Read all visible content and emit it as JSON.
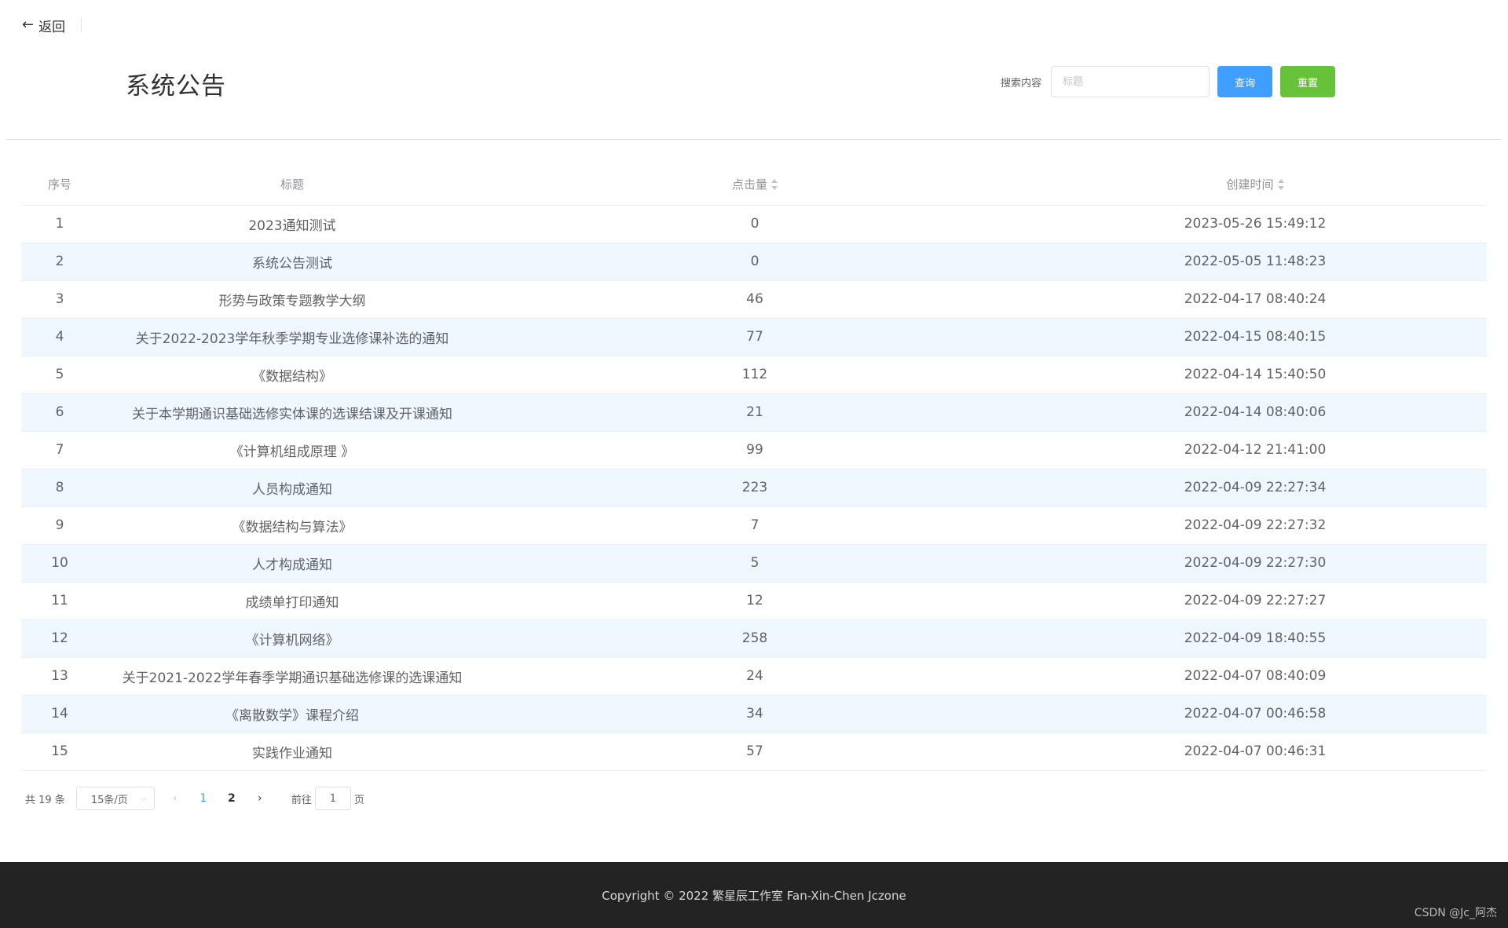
{
  "header": {
    "back_arrow": "←",
    "back_label": "返回",
    "title": "系统公告"
  },
  "search": {
    "label": "搜索内容",
    "placeholder": "标题",
    "value": "",
    "query_label": "查询",
    "reset_label": "重置"
  },
  "table": {
    "columns": [
      "序号",
      "标题",
      "点击量",
      "创建时间"
    ],
    "rows": [
      {
        "no": "1",
        "title": "2023通知测试",
        "clicks": "0",
        "created": "2023-05-26 15:49:12"
      },
      {
        "no": "2",
        "title": "系统公告测试",
        "clicks": "0",
        "created": "2022-05-05 11:48:23"
      },
      {
        "no": "3",
        "title": "形势与政策专题教学大纲",
        "clicks": "46",
        "created": "2022-04-17 08:40:24"
      },
      {
        "no": "4",
        "title": "关于2022-2023学年秋季学期专业选修课补选的通知",
        "clicks": "77",
        "created": "2022-04-15 08:40:15"
      },
      {
        "no": "5",
        "title": "《数据结构》",
        "clicks": "112",
        "created": "2022-04-14 15:40:50"
      },
      {
        "no": "6",
        "title": "关于本学期通识基础选修实体课的选课结课及开课通知",
        "clicks": "21",
        "created": "2022-04-14 08:40:06"
      },
      {
        "no": "7",
        "title": "《计算机组成原理 》",
        "clicks": "99",
        "created": "2022-04-12 21:41:00"
      },
      {
        "no": "8",
        "title": "人员构成通知",
        "clicks": "223",
        "created": "2022-04-09 22:27:34"
      },
      {
        "no": "9",
        "title": "《数据结构与算法》",
        "clicks": "7",
        "created": "2022-04-09 22:27:32"
      },
      {
        "no": "10",
        "title": "人才构成通知",
        "clicks": "5",
        "created": "2022-04-09 22:27:30"
      },
      {
        "no": "11",
        "title": "成绩单打印通知",
        "clicks": "12",
        "created": "2022-04-09 22:27:27"
      },
      {
        "no": "12",
        "title": "《计算机网络》",
        "clicks": "258",
        "created": "2022-04-09 18:40:55"
      },
      {
        "no": "13",
        "title": "关于2021-2022学年春季学期通识基础选修课的选课通知",
        "clicks": "24",
        "created": "2022-04-07 08:40:09"
      },
      {
        "no": "14",
        "title": "《离散数学》课程介绍",
        "clicks": "34",
        "created": "2022-04-07 00:46:58"
      },
      {
        "no": "15",
        "title": "实践作业通知",
        "clicks": "57",
        "created": "2022-04-07 00:46:31"
      }
    ]
  },
  "pagination": {
    "total_text": "共 19 条",
    "page_size": "15条/页",
    "prev_icon": "‹",
    "next_icon": "›",
    "pages": [
      "1",
      "2"
    ],
    "current_page": "1",
    "goto_label": "前往",
    "goto_value": "1",
    "page_suffix": "页"
  },
  "footer": {
    "copyright": "Copyright © 2022 繁星辰工作室 Fan-Xin-Chen Jczone",
    "watermark": "CSDN @Jc_阿杰"
  },
  "colors": {
    "primary": "#409eff",
    "success": "#67c23a",
    "footer_bg": "#232323",
    "stripe": "#f0f7ff"
  }
}
